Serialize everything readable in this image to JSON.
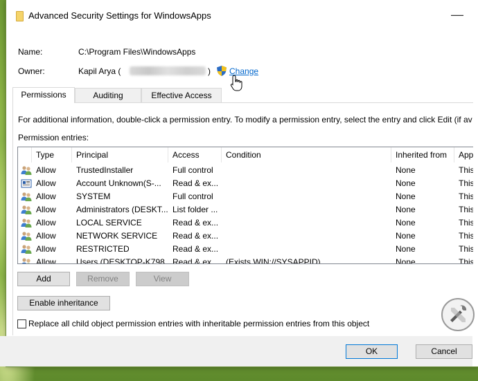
{
  "window": {
    "title": "Advanced Security Settings for WindowsApps",
    "minimize_glyph": "—"
  },
  "details": {
    "name_label": "Name:",
    "name_value": "C:\\Program Files\\WindowsApps",
    "owner_label": "Owner:",
    "owner_value": "Kapil Arya (",
    "owner_close": ")",
    "change_link": "Change"
  },
  "tabs": [
    {
      "label": "Permissions",
      "selected": true
    },
    {
      "label": "Auditing",
      "selected": false
    },
    {
      "label": "Effective Access",
      "selected": false
    }
  ],
  "permissions": {
    "info_text": "For additional information, double-click a permission entry. To modify a permission entry, select the entry and click Edit (if av",
    "entries_label": "Permission entries:",
    "columns": [
      "Type",
      "Principal",
      "Access",
      "Condition",
      "Inherited from",
      "Appli"
    ],
    "rows": [
      {
        "icon": "users-icon",
        "type": "Allow",
        "principal": "TrustedInstaller",
        "access": "Full control",
        "condition": "",
        "inherited": "None",
        "applies": "This f"
      },
      {
        "icon": "unknown-account-icon",
        "type": "Allow",
        "principal": "Account Unknown(S-...",
        "access": "Read & ex...",
        "condition": "",
        "inherited": "None",
        "applies": "This f"
      },
      {
        "icon": "users-icon",
        "type": "Allow",
        "principal": "SYSTEM",
        "access": "Full control",
        "condition": "",
        "inherited": "None",
        "applies": "This f"
      },
      {
        "icon": "users-icon",
        "type": "Allow",
        "principal": "Administrators (DESKT...",
        "access": "List folder ...",
        "condition": "",
        "inherited": "None",
        "applies": "This f"
      },
      {
        "icon": "users-icon",
        "type": "Allow",
        "principal": "LOCAL SERVICE",
        "access": "Read & ex...",
        "condition": "",
        "inherited": "None",
        "applies": "This f"
      },
      {
        "icon": "users-icon",
        "type": "Allow",
        "principal": "NETWORK SERVICE",
        "access": "Read & ex...",
        "condition": "",
        "inherited": "None",
        "applies": "This f"
      },
      {
        "icon": "users-icon",
        "type": "Allow",
        "principal": "RESTRICTED",
        "access": "Read & ex...",
        "condition": "",
        "inherited": "None",
        "applies": "This f"
      },
      {
        "icon": "users-icon",
        "type": "Allow",
        "principal": "Users (DESKTOP-K798...",
        "access": "Read & ex...",
        "condition": "(Exists WIN://SYSAPPID)",
        "inherited": "None",
        "applies": "This f"
      }
    ]
  },
  "buttons": {
    "add": "Add",
    "remove": "Remove",
    "view": "View",
    "enable_inheritance": "Enable inheritance",
    "ok": "OK",
    "cancel": "Cancel"
  },
  "replace_checkbox": {
    "label": "Replace all child object permission entries with inheritable permission entries from this object",
    "checked": false
  },
  "colors": {
    "link": "#0066cc",
    "focus_border": "#0078d7"
  }
}
